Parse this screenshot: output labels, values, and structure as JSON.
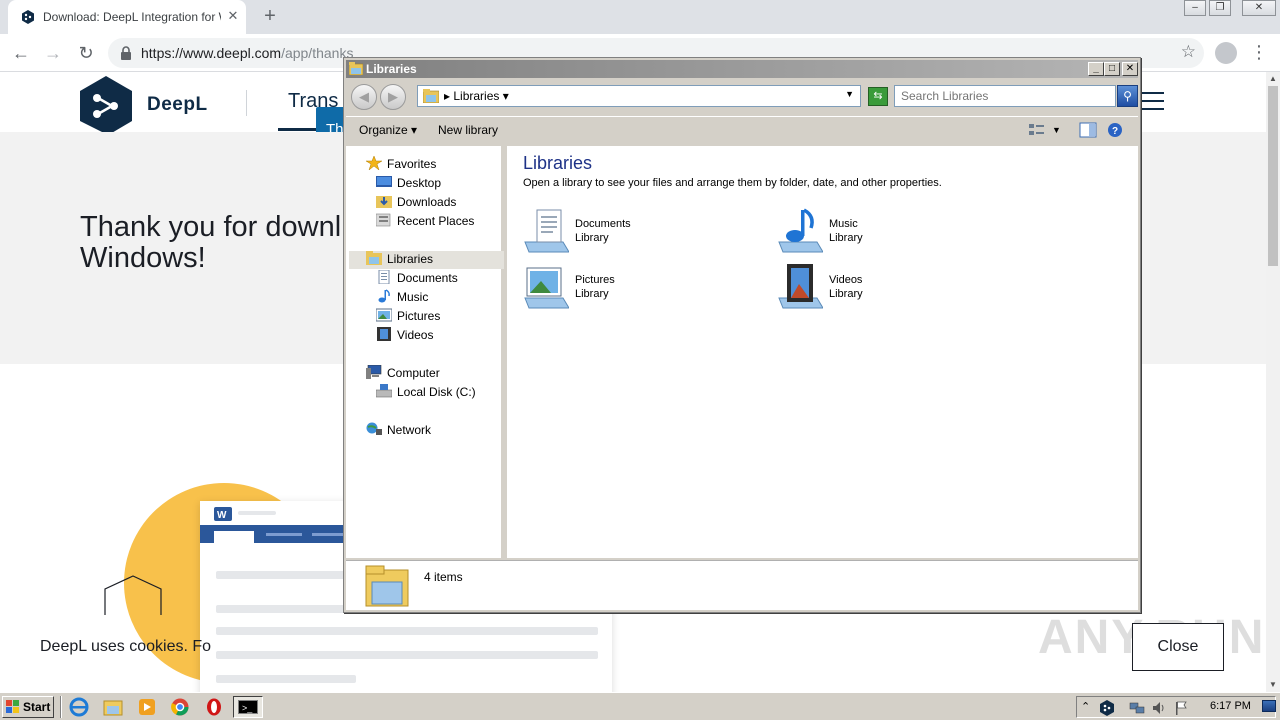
{
  "browser": {
    "tab_title": "Download: DeepL Integration for Wi",
    "tab_close": "✕",
    "new_tab": "+",
    "url_host": "https://www.deepl.com",
    "url_path": "/app/thanks",
    "back_glyph": "←",
    "forward_glyph": "→",
    "reload_glyph": "↻",
    "bookmark_glyph": "☆",
    "menu_glyph": "⋮"
  },
  "page": {
    "logo_text": "DeepL",
    "nav_translator": "Trans",
    "popup_text": "Th",
    "hero_title_line1": "Thank you for downl",
    "hero_title_line2": "Windows!",
    "cookie_text": "DeepL uses cookies. Fo",
    "close_button": "Close",
    "watermark": "ANY.RUN",
    "colors": {
      "brand_navy": "#0f2b46",
      "accent_blue": "#0f6ba8",
      "sun_yellow": "#f8c14b"
    }
  },
  "explorer": {
    "title": "Libraries",
    "address_label": "Libraries",
    "search_placeholder": "Search Libraries",
    "commands": {
      "organize": "Organize",
      "new_library": "New library"
    },
    "nav": {
      "favorites": "Favorites",
      "desktop": "Desktop",
      "downloads": "Downloads",
      "recent_places": "Recent Places",
      "libraries": "Libraries",
      "documents": "Documents",
      "music": "Music",
      "pictures": "Pictures",
      "videos": "Videos",
      "computer": "Computer",
      "local_disk": "Local Disk (C:)",
      "network": "Network"
    },
    "content_title": "Libraries",
    "content_subtitle": "Open a library to see your files and arrange them by folder, date, and other properties.",
    "libraries": [
      {
        "name": "Documents",
        "type": "Library",
        "icon": "documents-library-icon"
      },
      {
        "name": "Music",
        "type": "Library",
        "icon": "music-library-icon"
      },
      {
        "name": "Pictures",
        "type": "Library",
        "icon": "pictures-library-icon"
      },
      {
        "name": "Videos",
        "type": "Library",
        "icon": "videos-library-icon"
      }
    ],
    "status_text": "4 items"
  },
  "taskbar": {
    "start_label": "Start",
    "cmd_label": ">_",
    "clock": "6:17 PM"
  }
}
